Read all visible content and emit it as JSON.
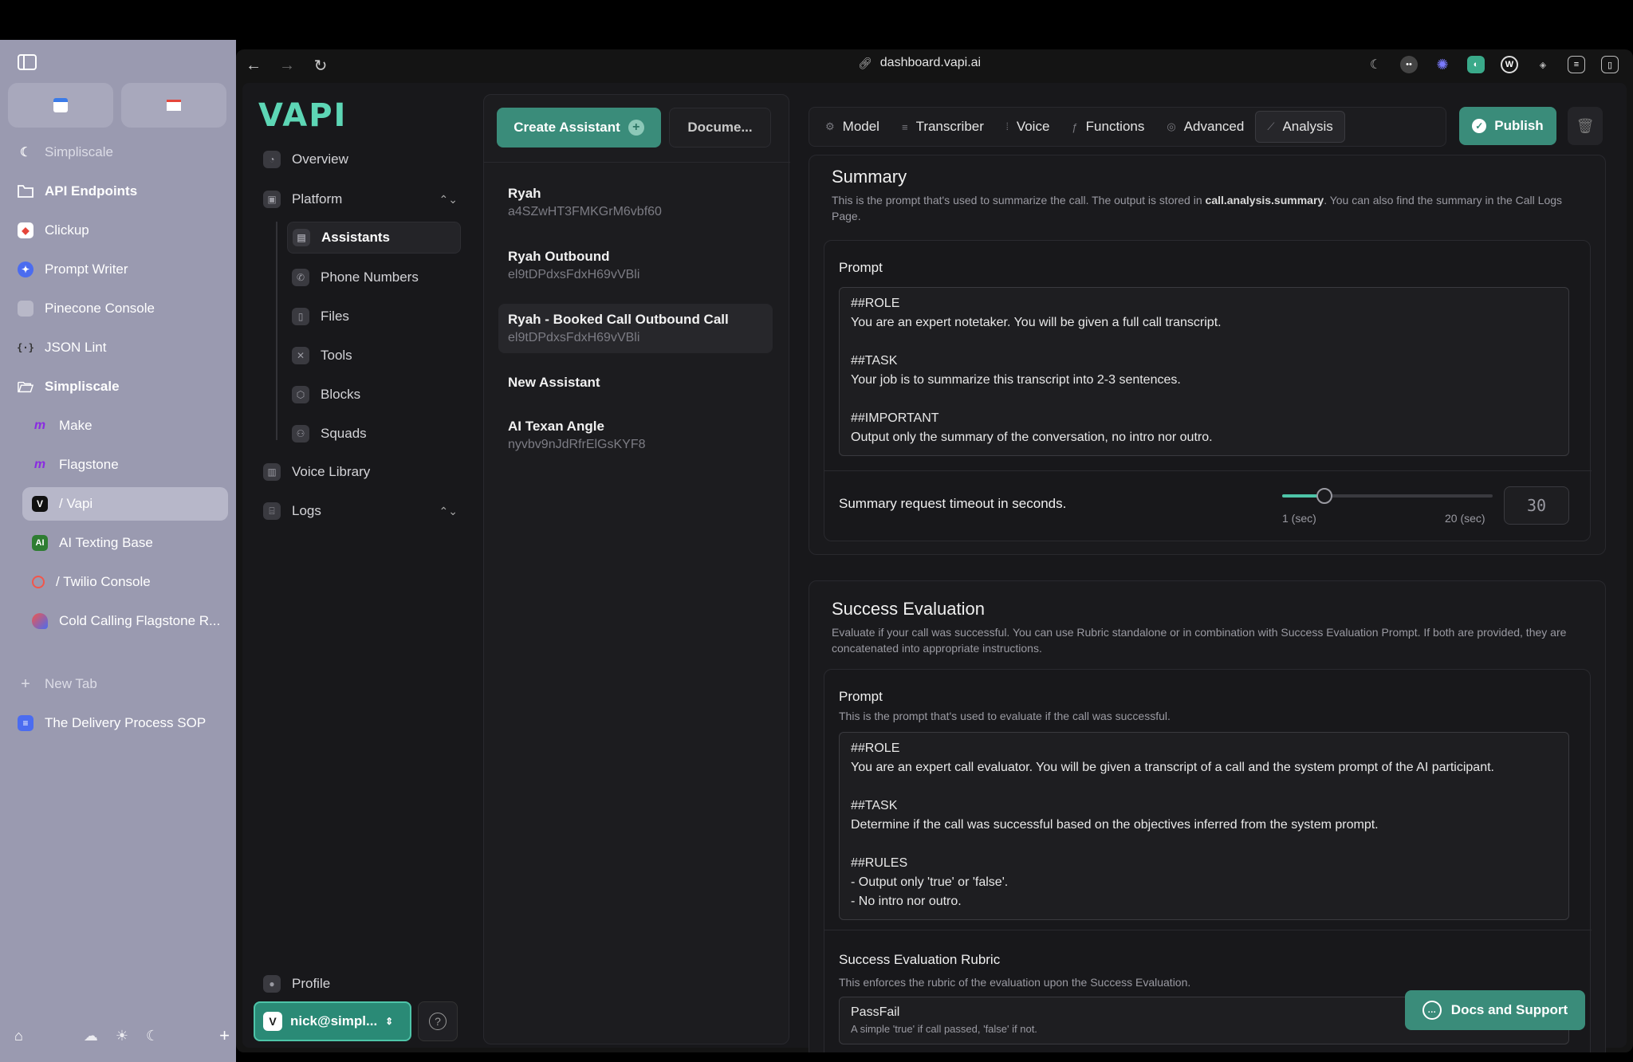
{
  "browser_sidebar": {
    "items": [
      {
        "label": "Simpliscale",
        "icon": "moon-icon"
      },
      {
        "label": "API Endpoints",
        "icon": "folder-icon"
      },
      {
        "label": "Clickup",
        "icon": "clickup-icon"
      },
      {
        "label": "Prompt Writer",
        "icon": "prompt-writer-icon"
      },
      {
        "label": "Pinecone Console",
        "icon": "pinecone-icon"
      },
      {
        "label": "JSON Lint",
        "icon": "json-icon"
      },
      {
        "label": "Simpliscale",
        "icon": "folder-open-icon"
      },
      {
        "label": "Make",
        "icon": "make-icon"
      },
      {
        "label": "Flagstone",
        "icon": "make-icon"
      },
      {
        "label": "/ Vapi",
        "icon": "vapi-icon"
      },
      {
        "label": "AI Texting Base",
        "icon": "ai-icon"
      },
      {
        "label": "/ Twilio Console",
        "icon": "twilio-icon"
      },
      {
        "label": "Cold Calling Flagstone R...",
        "icon": "cold-calling-icon"
      },
      {
        "label": "New Tab",
        "icon": "plus-icon"
      },
      {
        "label": "The Delivery Process SOP",
        "icon": "doc-icon"
      }
    ],
    "fav_icons": [
      "calendar-icon",
      "gmail-icon"
    ]
  },
  "browser": {
    "url": "dashboard.vapi.ai"
  },
  "app": {
    "logo": "VAPI",
    "nav": {
      "overview": "Overview",
      "platform": "Platform",
      "assistants": "Assistants",
      "phone_numbers": "Phone Numbers",
      "files": "Files",
      "tools": "Tools",
      "blocks": "Blocks",
      "squads": "Squads",
      "voice_library": "Voice Library",
      "logs": "Logs",
      "profile": "Profile",
      "user": "nick@simpl..."
    },
    "list": {
      "create_label": "Create Assistant",
      "docs_label": "Docume...",
      "assistants": [
        {
          "name": "Ryah",
          "id": "a4SZwHT3FMKGrM6vbf60"
        },
        {
          "name": "Ryah Outbound",
          "id": "el9tDPdxsFdxH69vVBli"
        },
        {
          "name": "Ryah - Booked Call Outbound Call",
          "id": "el9tDPdxsFdxH69vVBli"
        },
        {
          "name": "New Assistant",
          "id": ""
        },
        {
          "name": "AI Texan Angle",
          "id": "nyvbv9nJdRfrElGsKYF8"
        }
      ]
    },
    "tabs": [
      "Model",
      "Transcriber",
      "Voice",
      "Functions",
      "Advanced",
      "Analysis"
    ],
    "publish_label": "Publish",
    "summary": {
      "title": "Summary",
      "desc_pre": "This is the prompt that's used to summarize the call. The output is stored in ",
      "desc_bold": "call.analysis.summary",
      "desc_post": ". You can also find the summary in the Call Logs Page.",
      "prompt_label": "Prompt",
      "prompt_text": "##ROLE\nYou are an expert notetaker. You will be given a full call transcript.\n\n##TASK\nYour job is to summarize this transcript into 2-3 sentences.\n\n##IMPORTANT\nOutput only the summary of the conversation, no intro nor outro.",
      "timeout_label": "Summary request timeout in seconds.",
      "slider_min": "1 (sec)",
      "slider_max": "20 (sec)",
      "timeout_value": "30",
      "slider_fraction": 0.2
    },
    "success": {
      "title": "Success Evaluation",
      "desc": "Evaluate if your call was successful. You can use Rubric standalone or in combination with Success Evaluation Prompt. If both are provided, they are concatenated into appropriate instructions.",
      "prompt_label": "Prompt",
      "prompt_sub": "This is the prompt that's used to evaluate if the call was successful.",
      "prompt_text": "##ROLE\nYou are an expert call evaluator. You will be given a transcript of a call and the system prompt of the AI participant.\n\n##TASK\nDetermine if the call was successful based on the objectives inferred from the system prompt.\n\n##RULES\n- Output only 'true' or 'false'.\n- No intro nor outro.",
      "rubric_label": "Success Evaluation Rubric",
      "rubric_sub": "This enforces the rubric of the evaluation upon the Success Evaluation.",
      "rubric_value": "PassFail",
      "rubric_value_desc": "A simple 'true' if call passed, 'false' if not."
    },
    "docs_support": "Docs and Support"
  },
  "colors": {
    "accent": "#3a8c7a",
    "accent_light": "#4ec4a8",
    "sidebar_bg": "#9a9ab0"
  }
}
